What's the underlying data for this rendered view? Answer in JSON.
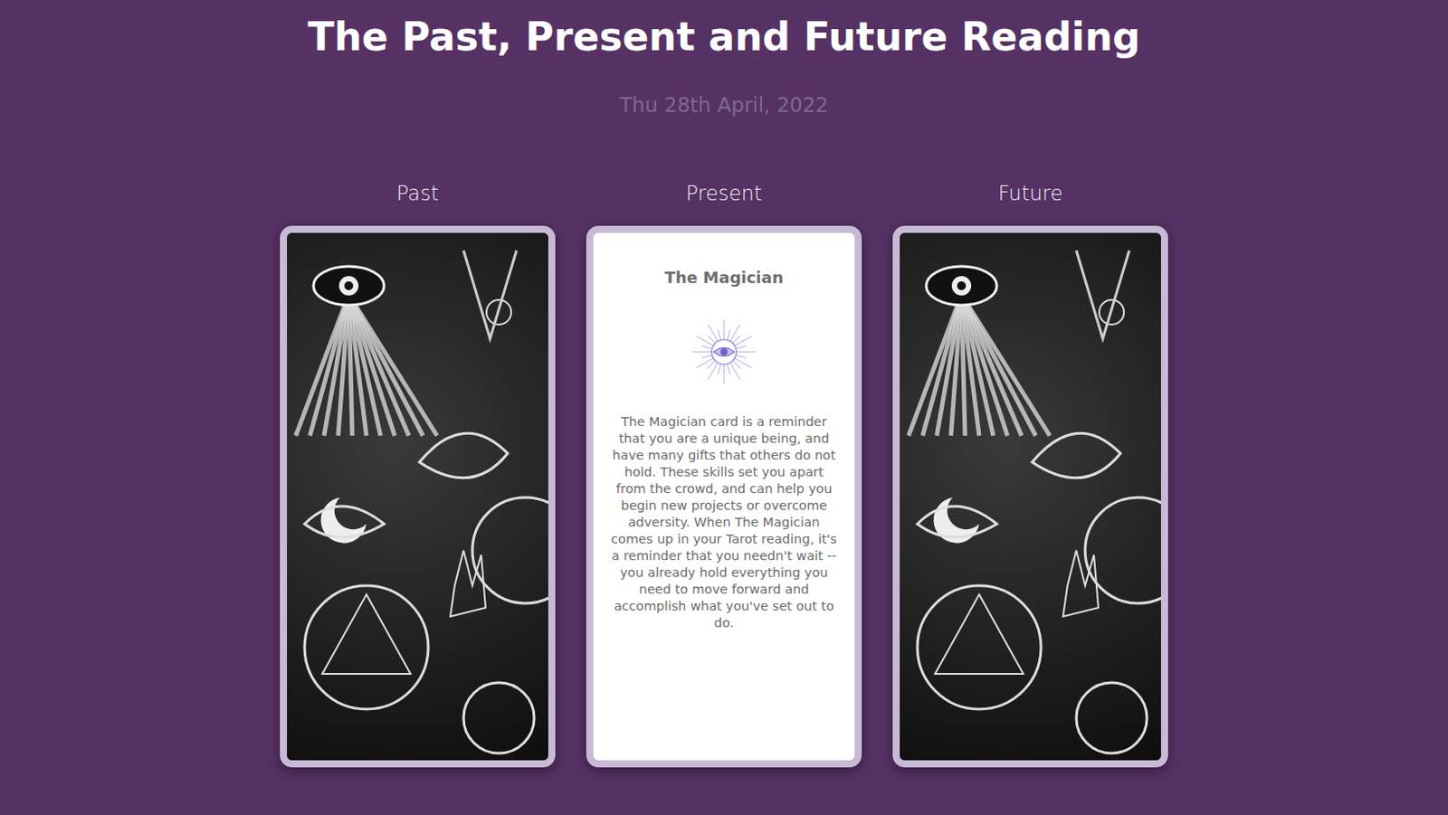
{
  "page": {
    "title": "The Past, Present and Future Reading",
    "date": "Thu 28th April, 2022"
  },
  "positions": [
    {
      "label": "Past",
      "revealed": false,
      "card": {
        "name": "",
        "description": ""
      }
    },
    {
      "label": "Present",
      "revealed": true,
      "card": {
        "name": "The Magician",
        "description": "The Magician card is a reminder that you are a unique being, and have many gifts that others do not hold. These skills set you apart from the crowd, and can help you begin new projects or overcome adversity. When The Magician comes up in your Tarot reading, it's a reminder that you needn't wait -- you already hold everything you need to move forward and accomplish what you've set out to do."
      }
    },
    {
      "label": "Future",
      "revealed": false,
      "card": {
        "name": "",
        "description": ""
      }
    }
  ]
}
